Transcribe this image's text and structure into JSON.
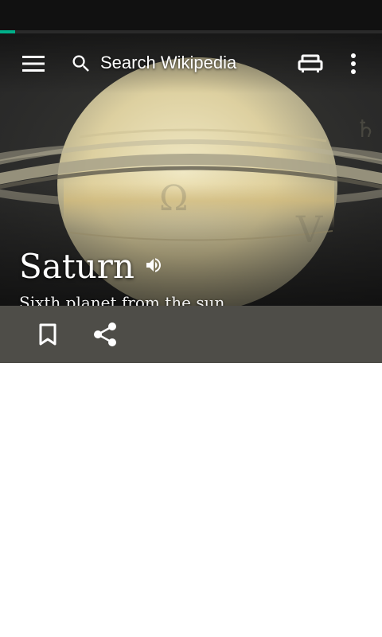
{
  "toolbar": {
    "search_placeholder": "Search Wikipedia",
    "icons": {
      "menu": "menu-icon",
      "search": "search-icon",
      "reading_lists": "reading-lists-icon",
      "overflow": "more-vert-icon"
    }
  },
  "load_progress": 0.04,
  "article": {
    "title": "Saturn",
    "description": "Sixth planet from the sun",
    "audio_icon": "speaker-icon"
  },
  "actions": {
    "save_icon": "bookmark-icon",
    "share_icon": "share-icon"
  },
  "colors": {
    "accent": "#00af89",
    "status_bar": "#111111",
    "action_bar": "#4e4d48",
    "text_on_image": "#ffffff"
  }
}
